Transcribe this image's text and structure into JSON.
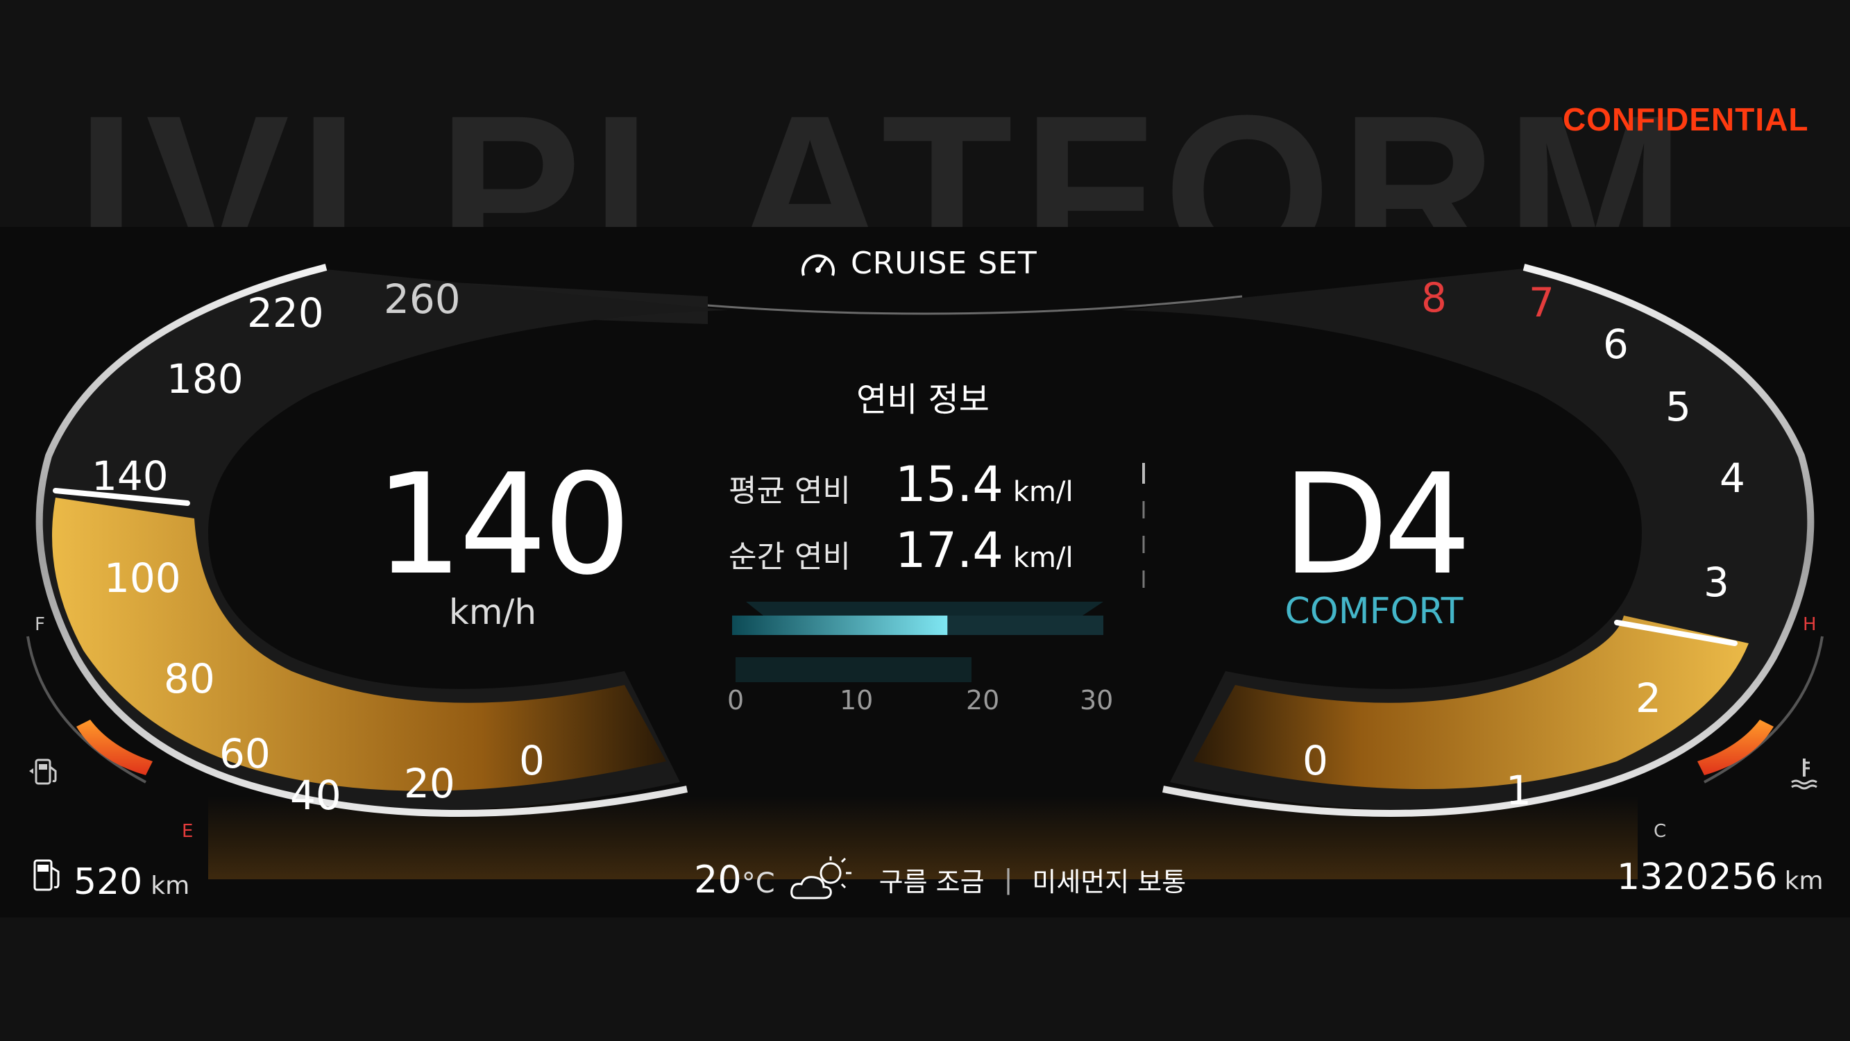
{
  "background_title": "IVI PLATFORM",
  "confidential": "CONFIDENTIAL",
  "cruise": {
    "icon": "cruise-control-icon",
    "label": "CRUISE SET"
  },
  "fuel_info": {
    "title": "연비 정보",
    "average_label": "평균 연비",
    "average_value": "15.4",
    "instant_label": "순간 연비",
    "instant_value": "17.4",
    "unit": "km/l",
    "bar_ticks": [
      "0",
      "10",
      "20",
      "30"
    ],
    "bar_value": 17.4,
    "bar_max": 30
  },
  "speed": {
    "value": "140",
    "unit": "km/h"
  },
  "gear": {
    "value": "D4",
    "mode": "COMFORT"
  },
  "speedometer": {
    "labels": [
      "0",
      "20",
      "40",
      "60",
      "80",
      "100",
      "140",
      "180",
      "220",
      "260"
    ],
    "current_kmh": 140
  },
  "tachometer": {
    "labels": [
      "0",
      "1",
      "2",
      "3",
      "4",
      "5",
      "6",
      "7",
      "8"
    ],
    "redline_labels": [
      "7",
      "8"
    ],
    "current_krpm": 2.4
  },
  "fuel_gauge": {
    "full": "F",
    "empty": "E",
    "icon": "fuel-pump-icon"
  },
  "temp_gauge": {
    "hot": "H",
    "cold": "C",
    "icon": "coolant-temp-icon"
  },
  "range": {
    "icon": "fuel-pump-icon",
    "value": "520",
    "unit": "km"
  },
  "odometer": {
    "value": "1320256",
    "unit": "km"
  },
  "weather": {
    "temperature": "20",
    "temp_unit": "°C",
    "icon": "partly-cloudy-icon",
    "condition": "구름 조금",
    "separator": "|",
    "air_quality": "미세먼지 보통"
  },
  "colors": {
    "accent_amber": "#f0a020",
    "mode_teal": "#44b6c9",
    "confidential_red": "#ff3b10",
    "redline": "#e43c3c"
  }
}
